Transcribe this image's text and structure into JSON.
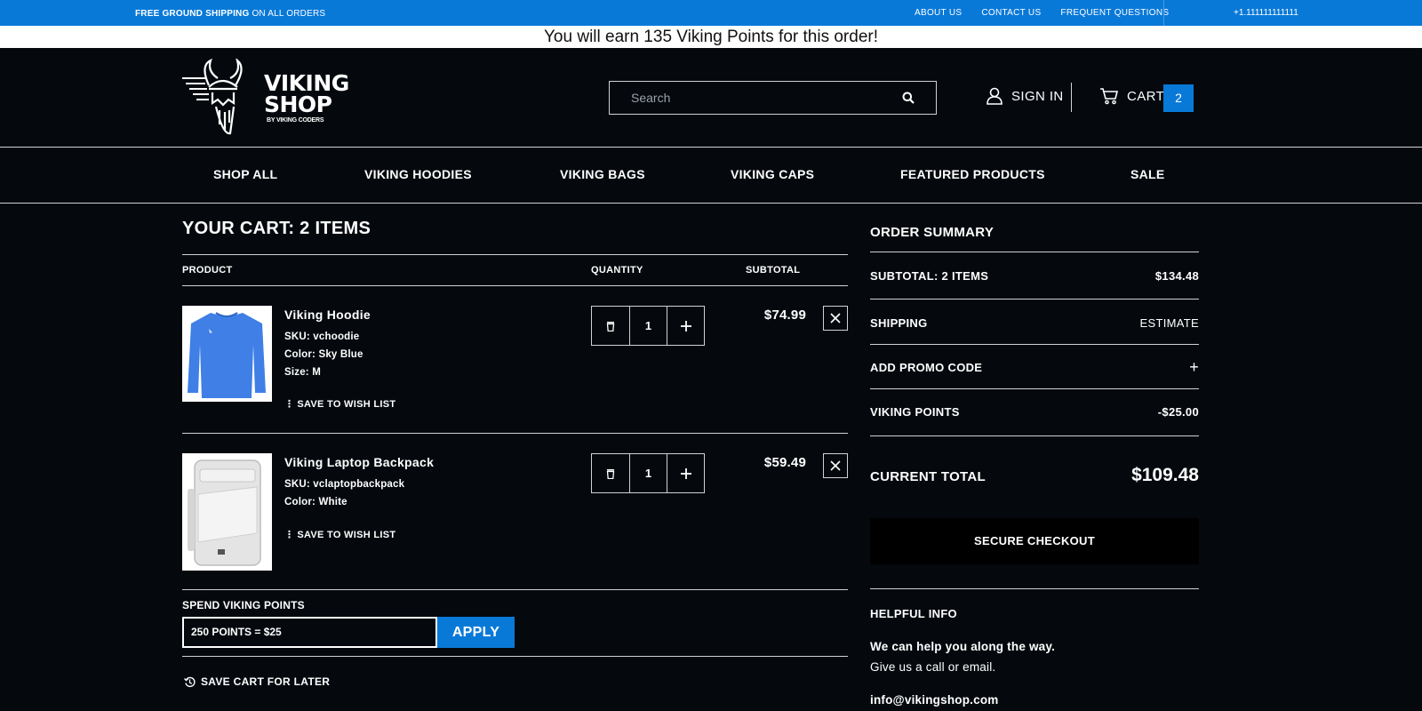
{
  "topbar": {
    "shipping_bold": "FREE GROUND SHIPPING",
    "shipping_rest": " ON ALL ORDERS",
    "links": [
      "ABOUT US",
      "CONTACT US",
      "FREQUENT QUESTIONS"
    ],
    "phone": "+1.111111111111"
  },
  "promo": {
    "text": "You will earn 135 Viking Points for this order!"
  },
  "header": {
    "brand_line1": "VIKING",
    "brand_line2": "SHOP",
    "brand_by": "BY VIKING CODERS",
    "search_placeholder": "Search",
    "signin_label": "SIGN IN",
    "cart_label": "CART",
    "cart_count": "2"
  },
  "nav": {
    "items": [
      "SHOP ALL",
      "VIKING HOODIES",
      "VIKING BAGS",
      "VIKING CAPS",
      "FEATURED PRODUCTS",
      "SALE"
    ]
  },
  "cart": {
    "title": "YOUR CART: 2 ITEMS",
    "col_product": "PRODUCT",
    "col_quantity": "QUANTITY",
    "col_subtotal": "SUBTOTAL",
    "wish_label": "SAVE TO WISH LIST",
    "items": [
      {
        "name": "Viking Hoodie",
        "sku": "SKU: vchoodie",
        "color": "Color: Sky Blue",
        "size": "Size: M",
        "qty": "1",
        "price": "$74.99",
        "thumb_color": "#3f7fe6"
      },
      {
        "name": "Viking Laptop Backpack",
        "sku": "SKU: vclaptopbackpack",
        "color": "Color: White",
        "qty": "1",
        "price": "$59.49",
        "thumb_color": "#e9e9e9"
      }
    ],
    "points_label": "SPEND VIKING POINTS",
    "points_value": "250 POINTS = $25",
    "apply_label": "APPLY",
    "save_later_label": "SAVE CART FOR LATER"
  },
  "summary": {
    "title": "ORDER SUMMARY",
    "subtotal_label": "SUBTOTAL: 2 ITEMS",
    "subtotal_value": "$134.48",
    "shipping_label": "SHIPPING",
    "shipping_value": "ESTIMATE",
    "promo_label": "ADD PROMO CODE",
    "promo_toggle": "+",
    "points_label": "VIKING POINTS",
    "points_value": "-$25.00",
    "total_label": "CURRENT TOTAL",
    "total_value": "$109.48",
    "checkout_label": "SECURE CHECKOUT",
    "help_title": "HELPFUL INFO",
    "help_line1": "We can help you along the way.",
    "help_line2": "Give us a call or email.",
    "help_email": "info@vikingshop.com"
  },
  "colors": {
    "accent": "#0979d8",
    "background": "#05090e",
    "divider": "#cfd3d8"
  }
}
